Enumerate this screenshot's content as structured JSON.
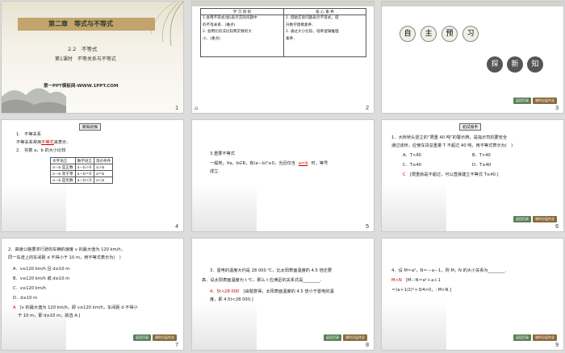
{
  "slides": [
    {
      "num": "1",
      "chapter": "第二章　等式与不等式",
      "section": "2.2　不等式",
      "lesson": "第1课时　不等关系与不等式",
      "watermark": "第一PPT模板网-WWW.1PPT.COM"
    },
    {
      "num": "2",
      "headers": [
        "学 习 目 标",
        "核 心 素 养"
      ],
      "left": [
        "1.会用不等式(组)表示实际问题中",
        "的不等关系．(难点)",
        "2. 会用比较法比较两实数的大",
        "小．(重点)"
      ],
      "right": [
        "1. 借助实际问题表示不等式，提",
        "升数学建模素养．",
        "2. 通过大小比较，培养逻辑推理",
        "素养．"
      ]
    },
    {
      "num": "3",
      "title": [
        "自",
        "主",
        "预",
        "习"
      ],
      "sub": [
        "探",
        "新",
        "知"
      ]
    },
    {
      "num": "4",
      "badge": "新知初探",
      "lines": [
        "1.　不等关系",
        "不等关系常用",
        "来表示．",
        "2.　实数 a，b 的大小比较"
      ],
      "blank": "不等式",
      "table_head": [
        "文字语言",
        "数学语言",
        "等价条件"
      ],
      "table_rows": [
        [
          "a－b 是正数",
          "a－b＞0",
          "a＞b"
        ],
        [
          "a－b 等于零",
          "a－b＝0",
          "a＝b"
        ],
        [
          "a－b 是负数",
          "a－b＜0",
          "a＜b"
        ]
      ]
    },
    {
      "num": "5",
      "lines": [
        "3.重要不等式",
        "一般地，∀a，b∈R，有(a－b)²≥0，当且仅当",
        "时，等号",
        "成立．"
      ],
      "blank": "a＝b"
    },
    {
      "num": "6",
      "badge": "初试身手",
      "q": [
        "1．大桥桥头竖立的“限重 40 吨”的警示牌，是指示司机要安全",
        "通过该桥，应使车货总重量 T 不超过 40 吨，用不等式表示为(　)"
      ],
      "opts": [
        "A．T<40",
        "B．T>40",
        "C．T≤40",
        "D．T≥40"
      ],
      "ans": "C",
      "ans_text": "[限重就是不超过，可以直接建立不等式 T≤40.]"
    },
    {
      "num": "7",
      "q": [
        "2．高速公路要求行驶的车辆的速度 v 的最大值为 120 km/h，",
        "同一车道上的车间距 d 不得小于 10 m，用不等式表示为(　)"
      ],
      "opts": [
        "A．v≤120 km/h 且 d≥10 m",
        "B．v≤120 km/h 或 d≥10 m",
        "C．v≤120 km/h",
        "D．d≥10 m"
      ],
      "ans": "A",
      "ans_text": [
        "[v 的最大值为 120 km/h，即 v≤120 km/h，车间距 d 不得小",
        "于 10 m，即 d≥10 m，故选 A.]"
      ]
    },
    {
      "num": "8",
      "q": [
        "3．雷电的温度大约是 28 000 ℃，比太阳表面温度的 4.5 倍还要",
        "高．设太阳表面温度为 t ℃，那么 t 应满足的关系式是________．"
      ],
      "ans": "4．5t<28 000",
      "ans_text": [
        "[由题意得，太阳表面温度的 4.5 倍小于雷电的温",
        "度，即 4.5t<28 000.]"
      ]
    },
    {
      "num": "9",
      "q": "4．设 M＝a²，N＝－a－1，则 M，N 的大小关系为________．",
      "ans": "M>N",
      "a1": "[M－N＝a²＋a＋1",
      "a2": "＝(a＋1/2)²＋3/4>0，∴M>N.]"
    }
  ],
  "buttons": {
    "prev": "返回目录",
    "next": "课时分层作业"
  }
}
